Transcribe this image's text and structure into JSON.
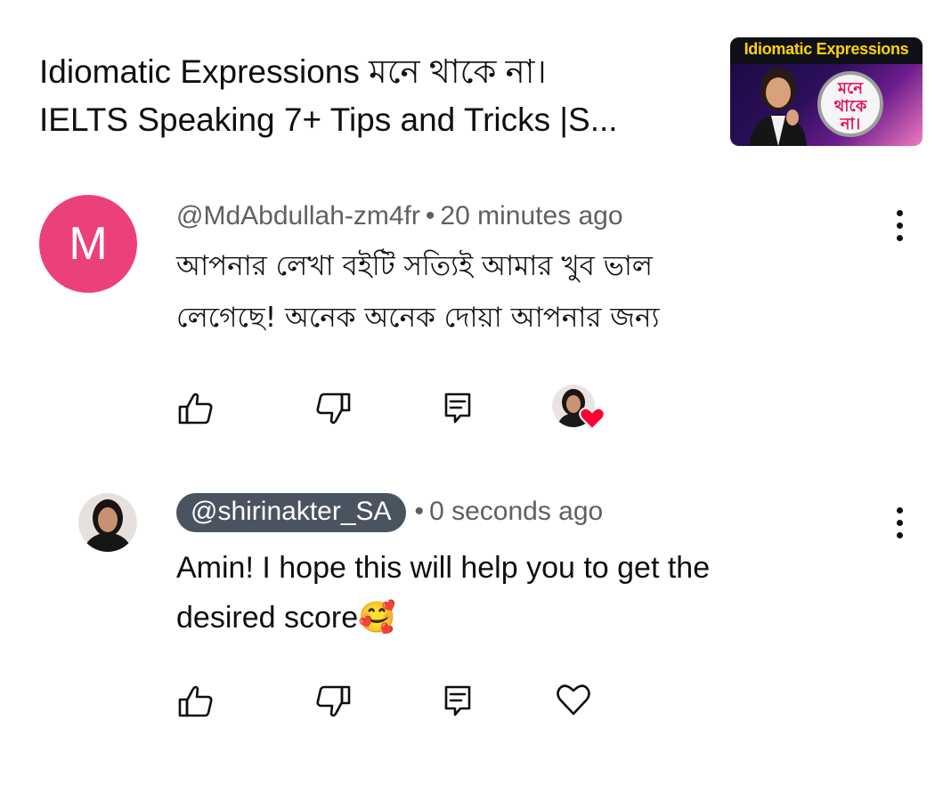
{
  "video": {
    "title_line1": "Idiomatic Expressions মনে থাকে না।",
    "title_line2": "IELTS Speaking 7+ Tips and Tricks |S...",
    "thumbnail": {
      "banner_text": "Idiomatic Expressions",
      "badge_line1": "মনে",
      "badge_line2": "থাকে",
      "badge_line3": "না।",
      "accent_color": "#ffd400",
      "badge_text_color": "#e0115f"
    }
  },
  "comments": [
    {
      "avatar_letter": "M",
      "avatar_color": "#ec407a",
      "author": "@MdAbdullah-zm4fr",
      "separator": "•",
      "time": "20 minutes ago",
      "text_line1": "আপনার লেখা বইটি সত্যিই আমার খুব ভাল",
      "text_line2": "লেগেছে! অনেক অনেক দোয়া আপনার জন্য",
      "actions": {
        "like_icon": "thumbs-up-icon",
        "dislike_icon": "thumbs-down-icon",
        "reply_icon": "reply-comment-icon",
        "creator_heart": "creator-heart-icon"
      }
    },
    {
      "author": "@shirinakter_SA",
      "author_is_creator": true,
      "separator": "•",
      "time": "0 seconds ago",
      "text_line1": "Amin! I hope this will help you to get the",
      "text_line2": "desired score🥰",
      "actions": {
        "like_icon": "thumbs-up-icon",
        "dislike_icon": "thumbs-down-icon",
        "reply_icon": "reply-comment-icon",
        "heart_icon": "heart-outline-icon"
      }
    }
  ]
}
